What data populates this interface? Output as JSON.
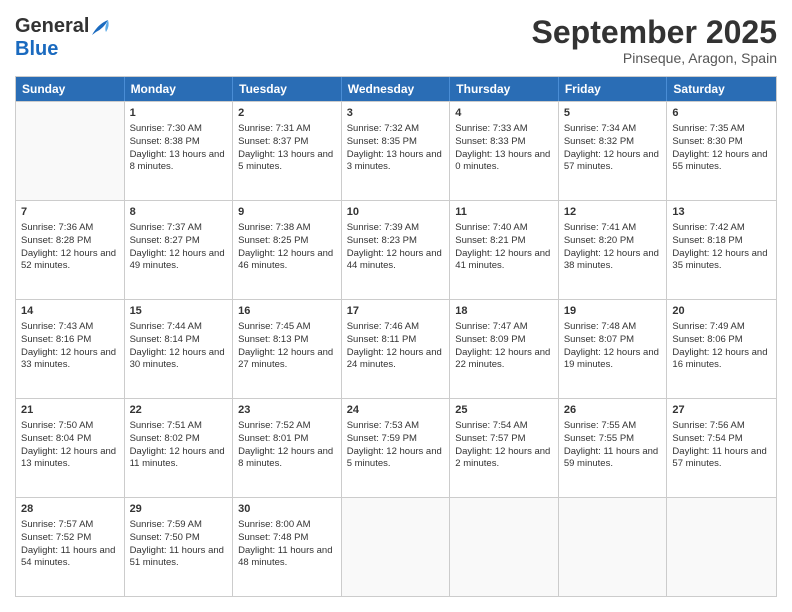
{
  "logo": {
    "general": "General",
    "blue": "Blue"
  },
  "title": "September 2025",
  "location": "Pinseque, Aragon, Spain",
  "days": [
    "Sunday",
    "Monday",
    "Tuesday",
    "Wednesday",
    "Thursday",
    "Friday",
    "Saturday"
  ],
  "weeks": [
    [
      {
        "num": "",
        "sunrise": "",
        "sunset": "",
        "daylight": ""
      },
      {
        "num": "1",
        "sunrise": "Sunrise: 7:30 AM",
        "sunset": "Sunset: 8:38 PM",
        "daylight": "Daylight: 13 hours and 8 minutes."
      },
      {
        "num": "2",
        "sunrise": "Sunrise: 7:31 AM",
        "sunset": "Sunset: 8:37 PM",
        "daylight": "Daylight: 13 hours and 5 minutes."
      },
      {
        "num": "3",
        "sunrise": "Sunrise: 7:32 AM",
        "sunset": "Sunset: 8:35 PM",
        "daylight": "Daylight: 13 hours and 3 minutes."
      },
      {
        "num": "4",
        "sunrise": "Sunrise: 7:33 AM",
        "sunset": "Sunset: 8:33 PM",
        "daylight": "Daylight: 13 hours and 0 minutes."
      },
      {
        "num": "5",
        "sunrise": "Sunrise: 7:34 AM",
        "sunset": "Sunset: 8:32 PM",
        "daylight": "Daylight: 12 hours and 57 minutes."
      },
      {
        "num": "6",
        "sunrise": "Sunrise: 7:35 AM",
        "sunset": "Sunset: 8:30 PM",
        "daylight": "Daylight: 12 hours and 55 minutes."
      }
    ],
    [
      {
        "num": "7",
        "sunrise": "Sunrise: 7:36 AM",
        "sunset": "Sunset: 8:28 PM",
        "daylight": "Daylight: 12 hours and 52 minutes."
      },
      {
        "num": "8",
        "sunrise": "Sunrise: 7:37 AM",
        "sunset": "Sunset: 8:27 PM",
        "daylight": "Daylight: 12 hours and 49 minutes."
      },
      {
        "num": "9",
        "sunrise": "Sunrise: 7:38 AM",
        "sunset": "Sunset: 8:25 PM",
        "daylight": "Daylight: 12 hours and 46 minutes."
      },
      {
        "num": "10",
        "sunrise": "Sunrise: 7:39 AM",
        "sunset": "Sunset: 8:23 PM",
        "daylight": "Daylight: 12 hours and 44 minutes."
      },
      {
        "num": "11",
        "sunrise": "Sunrise: 7:40 AM",
        "sunset": "Sunset: 8:21 PM",
        "daylight": "Daylight: 12 hours and 41 minutes."
      },
      {
        "num": "12",
        "sunrise": "Sunrise: 7:41 AM",
        "sunset": "Sunset: 8:20 PM",
        "daylight": "Daylight: 12 hours and 38 minutes."
      },
      {
        "num": "13",
        "sunrise": "Sunrise: 7:42 AM",
        "sunset": "Sunset: 8:18 PM",
        "daylight": "Daylight: 12 hours and 35 minutes."
      }
    ],
    [
      {
        "num": "14",
        "sunrise": "Sunrise: 7:43 AM",
        "sunset": "Sunset: 8:16 PM",
        "daylight": "Daylight: 12 hours and 33 minutes."
      },
      {
        "num": "15",
        "sunrise": "Sunrise: 7:44 AM",
        "sunset": "Sunset: 8:14 PM",
        "daylight": "Daylight: 12 hours and 30 minutes."
      },
      {
        "num": "16",
        "sunrise": "Sunrise: 7:45 AM",
        "sunset": "Sunset: 8:13 PM",
        "daylight": "Daylight: 12 hours and 27 minutes."
      },
      {
        "num": "17",
        "sunrise": "Sunrise: 7:46 AM",
        "sunset": "Sunset: 8:11 PM",
        "daylight": "Daylight: 12 hours and 24 minutes."
      },
      {
        "num": "18",
        "sunrise": "Sunrise: 7:47 AM",
        "sunset": "Sunset: 8:09 PM",
        "daylight": "Daylight: 12 hours and 22 minutes."
      },
      {
        "num": "19",
        "sunrise": "Sunrise: 7:48 AM",
        "sunset": "Sunset: 8:07 PM",
        "daylight": "Daylight: 12 hours and 19 minutes."
      },
      {
        "num": "20",
        "sunrise": "Sunrise: 7:49 AM",
        "sunset": "Sunset: 8:06 PM",
        "daylight": "Daylight: 12 hours and 16 minutes."
      }
    ],
    [
      {
        "num": "21",
        "sunrise": "Sunrise: 7:50 AM",
        "sunset": "Sunset: 8:04 PM",
        "daylight": "Daylight: 12 hours and 13 minutes."
      },
      {
        "num": "22",
        "sunrise": "Sunrise: 7:51 AM",
        "sunset": "Sunset: 8:02 PM",
        "daylight": "Daylight: 12 hours and 11 minutes."
      },
      {
        "num": "23",
        "sunrise": "Sunrise: 7:52 AM",
        "sunset": "Sunset: 8:01 PM",
        "daylight": "Daylight: 12 hours and 8 minutes."
      },
      {
        "num": "24",
        "sunrise": "Sunrise: 7:53 AM",
        "sunset": "Sunset: 7:59 PM",
        "daylight": "Daylight: 12 hours and 5 minutes."
      },
      {
        "num": "25",
        "sunrise": "Sunrise: 7:54 AM",
        "sunset": "Sunset: 7:57 PM",
        "daylight": "Daylight: 12 hours and 2 minutes."
      },
      {
        "num": "26",
        "sunrise": "Sunrise: 7:55 AM",
        "sunset": "Sunset: 7:55 PM",
        "daylight": "Daylight: 11 hours and 59 minutes."
      },
      {
        "num": "27",
        "sunrise": "Sunrise: 7:56 AM",
        "sunset": "Sunset: 7:54 PM",
        "daylight": "Daylight: 11 hours and 57 minutes."
      }
    ],
    [
      {
        "num": "28",
        "sunrise": "Sunrise: 7:57 AM",
        "sunset": "Sunset: 7:52 PM",
        "daylight": "Daylight: 11 hours and 54 minutes."
      },
      {
        "num": "29",
        "sunrise": "Sunrise: 7:59 AM",
        "sunset": "Sunset: 7:50 PM",
        "daylight": "Daylight: 11 hours and 51 minutes."
      },
      {
        "num": "30",
        "sunrise": "Sunrise: 8:00 AM",
        "sunset": "Sunset: 7:48 PM",
        "daylight": "Daylight: 11 hours and 48 minutes."
      },
      {
        "num": "",
        "sunrise": "",
        "sunset": "",
        "daylight": ""
      },
      {
        "num": "",
        "sunrise": "",
        "sunset": "",
        "daylight": ""
      },
      {
        "num": "",
        "sunrise": "",
        "sunset": "",
        "daylight": ""
      },
      {
        "num": "",
        "sunrise": "",
        "sunset": "",
        "daylight": ""
      }
    ]
  ]
}
